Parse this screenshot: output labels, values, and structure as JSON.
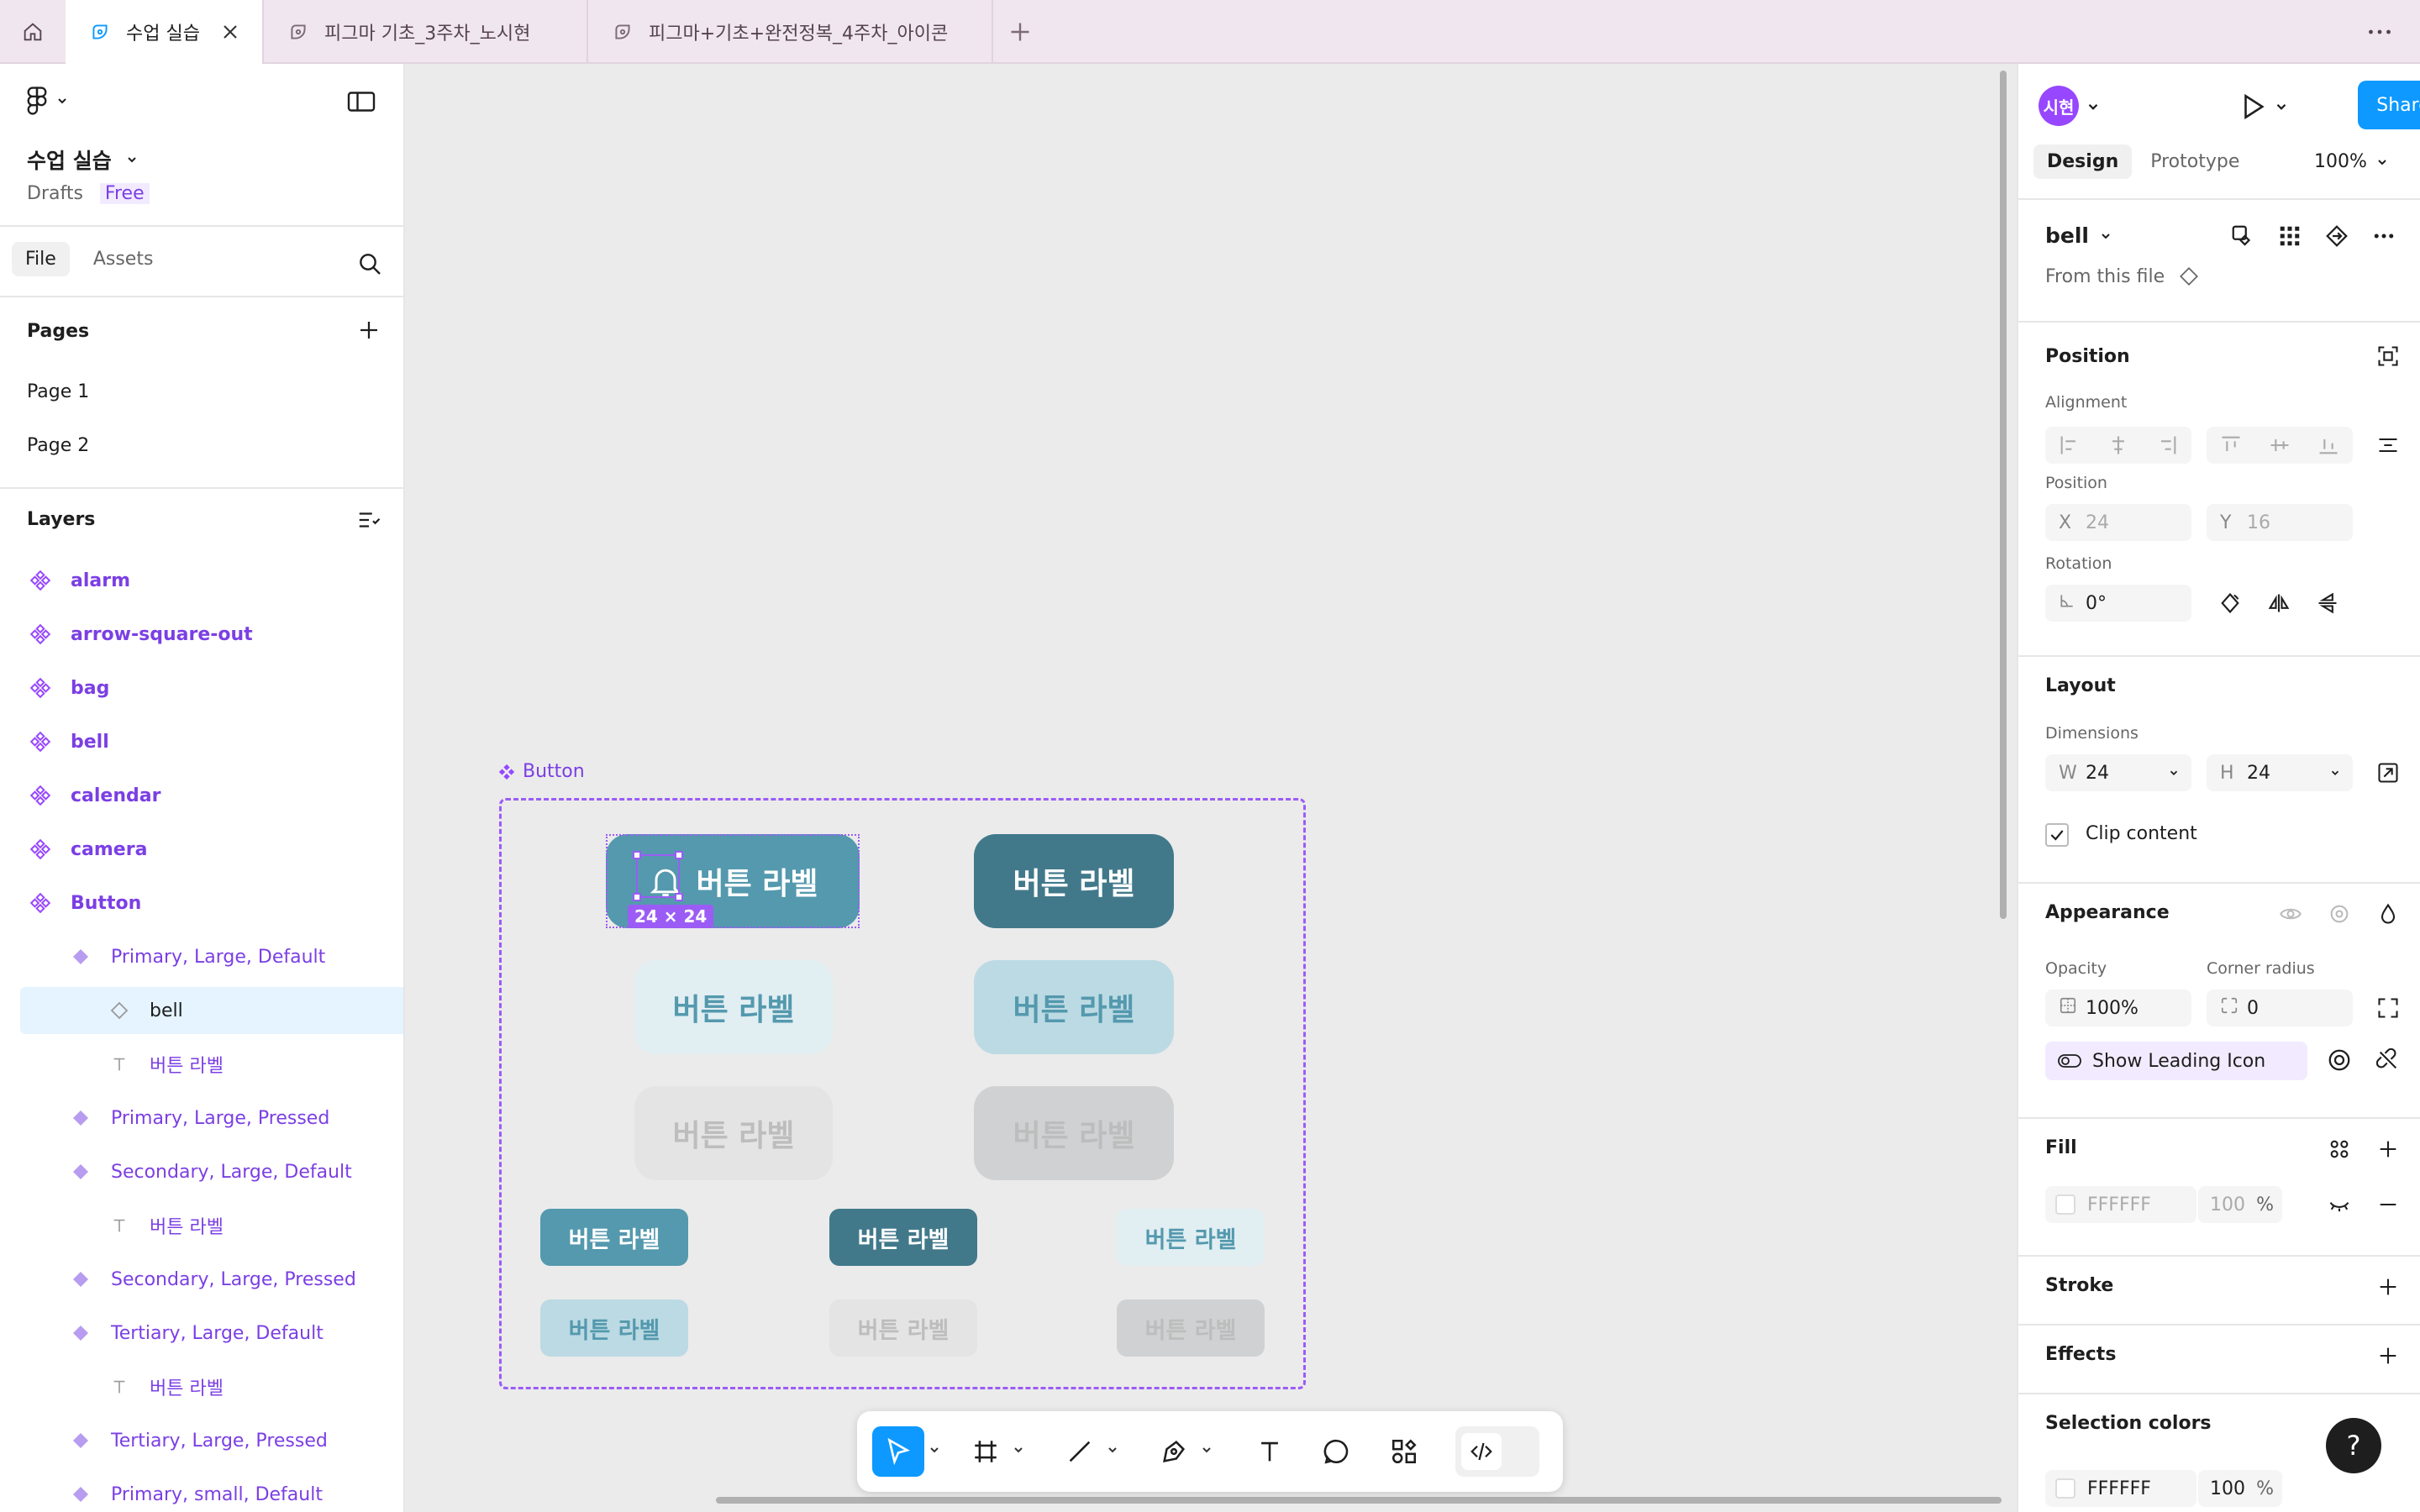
{
  "tabs": [
    {
      "label": "수업 실습",
      "active": true
    },
    {
      "label": "피그마 기초_3주차_노시현",
      "active": false
    },
    {
      "label": "피그마+기초+완전정복_4주차_아이콘",
      "active": false
    }
  ],
  "left_panel": {
    "file_title": "수업 실습",
    "drafts": "Drafts",
    "plan": "Free",
    "tabs": [
      "File",
      "Assets"
    ],
    "pages_title": "Pages",
    "pages": [
      "Page 1",
      "Page 2"
    ],
    "layers_title": "Layers",
    "layers": [
      {
        "name": "alarm",
        "kind": "component"
      },
      {
        "name": "arrow-square-out",
        "kind": "component"
      },
      {
        "name": "bag",
        "kind": "component"
      },
      {
        "name": "bell",
        "kind": "component"
      },
      {
        "name": "calendar",
        "kind": "component"
      },
      {
        "name": "camera",
        "kind": "component"
      },
      {
        "name": "Button",
        "kind": "component-set"
      },
      {
        "name": "Primary, Large, Default",
        "kind": "variant"
      },
      {
        "name": "bell",
        "kind": "instance",
        "selected": true
      },
      {
        "name": "버튼 라벨",
        "kind": "text"
      },
      {
        "name": "Primary, Large, Pressed",
        "kind": "variant"
      },
      {
        "name": "Secondary, Large, Default",
        "kind": "variant"
      },
      {
        "name": "버튼 라벨",
        "kind": "text"
      },
      {
        "name": "Secondary, Large, Pressed",
        "kind": "variant"
      },
      {
        "name": "Tertiary, Large, Default",
        "kind": "variant"
      },
      {
        "name": "버튼 라벨",
        "kind": "text"
      },
      {
        "name": "Tertiary, Large, Pressed",
        "kind": "variant"
      },
      {
        "name": "Primary, small, Default",
        "kind": "variant"
      }
    ]
  },
  "canvas": {
    "frame_label": "Button",
    "selection_size": "24 × 24",
    "button_label": "버튼 라벨",
    "colors": {
      "primary": "#5499ae",
      "primary_pressed": "#41798b",
      "secondary_bg": "#e1eef2",
      "secondary_text": "#5499ae",
      "secondary_pressed_bg": "#bcdae3",
      "disabled_bg": "#e4e4e4",
      "disabled_text": "#bdbdbd",
      "disabled_pressed_bg": "#cfd1d2",
      "selection": "#9b5cf5"
    }
  },
  "toolbar": {
    "tools": [
      "move-tool",
      "frame-tool",
      "line-tool",
      "pen-tool",
      "text-tool",
      "comment-tool",
      "actions-tool",
      "dev-mode-toggle"
    ]
  },
  "right_panel": {
    "avatar": "시현",
    "share_label": "Share",
    "tabs": [
      "Design",
      "Prototype"
    ],
    "zoom": "100%",
    "component_name": "bell",
    "from_file": "From this file",
    "position_title": "Position",
    "alignment_label": "Alignment",
    "position_label": "Position",
    "x_label": "X",
    "x_value": "24",
    "y_label": "Y",
    "y_value": "16",
    "rotation_label": "Rotation",
    "rotation_value": "0°",
    "layout_title": "Layout",
    "dimensions_label": "Dimensions",
    "w_label": "W",
    "w_value": "24",
    "h_label": "H",
    "h_value": "24",
    "clip_content": "Clip content",
    "appearance_title": "Appearance",
    "opacity_label": "Opacity",
    "opacity_value": "100%",
    "corner_radius_label": "Corner radius",
    "corner_radius_value": "0",
    "show_leading_icon": "Show Leading Icon",
    "fill_title": "Fill",
    "fill_hex": "FFFFFF",
    "fill_opacity": "100",
    "percent": "%",
    "stroke_title": "Stroke",
    "effects_title": "Effects",
    "selection_colors_title": "Selection colors",
    "selection_hex": "FFFFFF",
    "selection_opacity": "100",
    "help": "?"
  }
}
